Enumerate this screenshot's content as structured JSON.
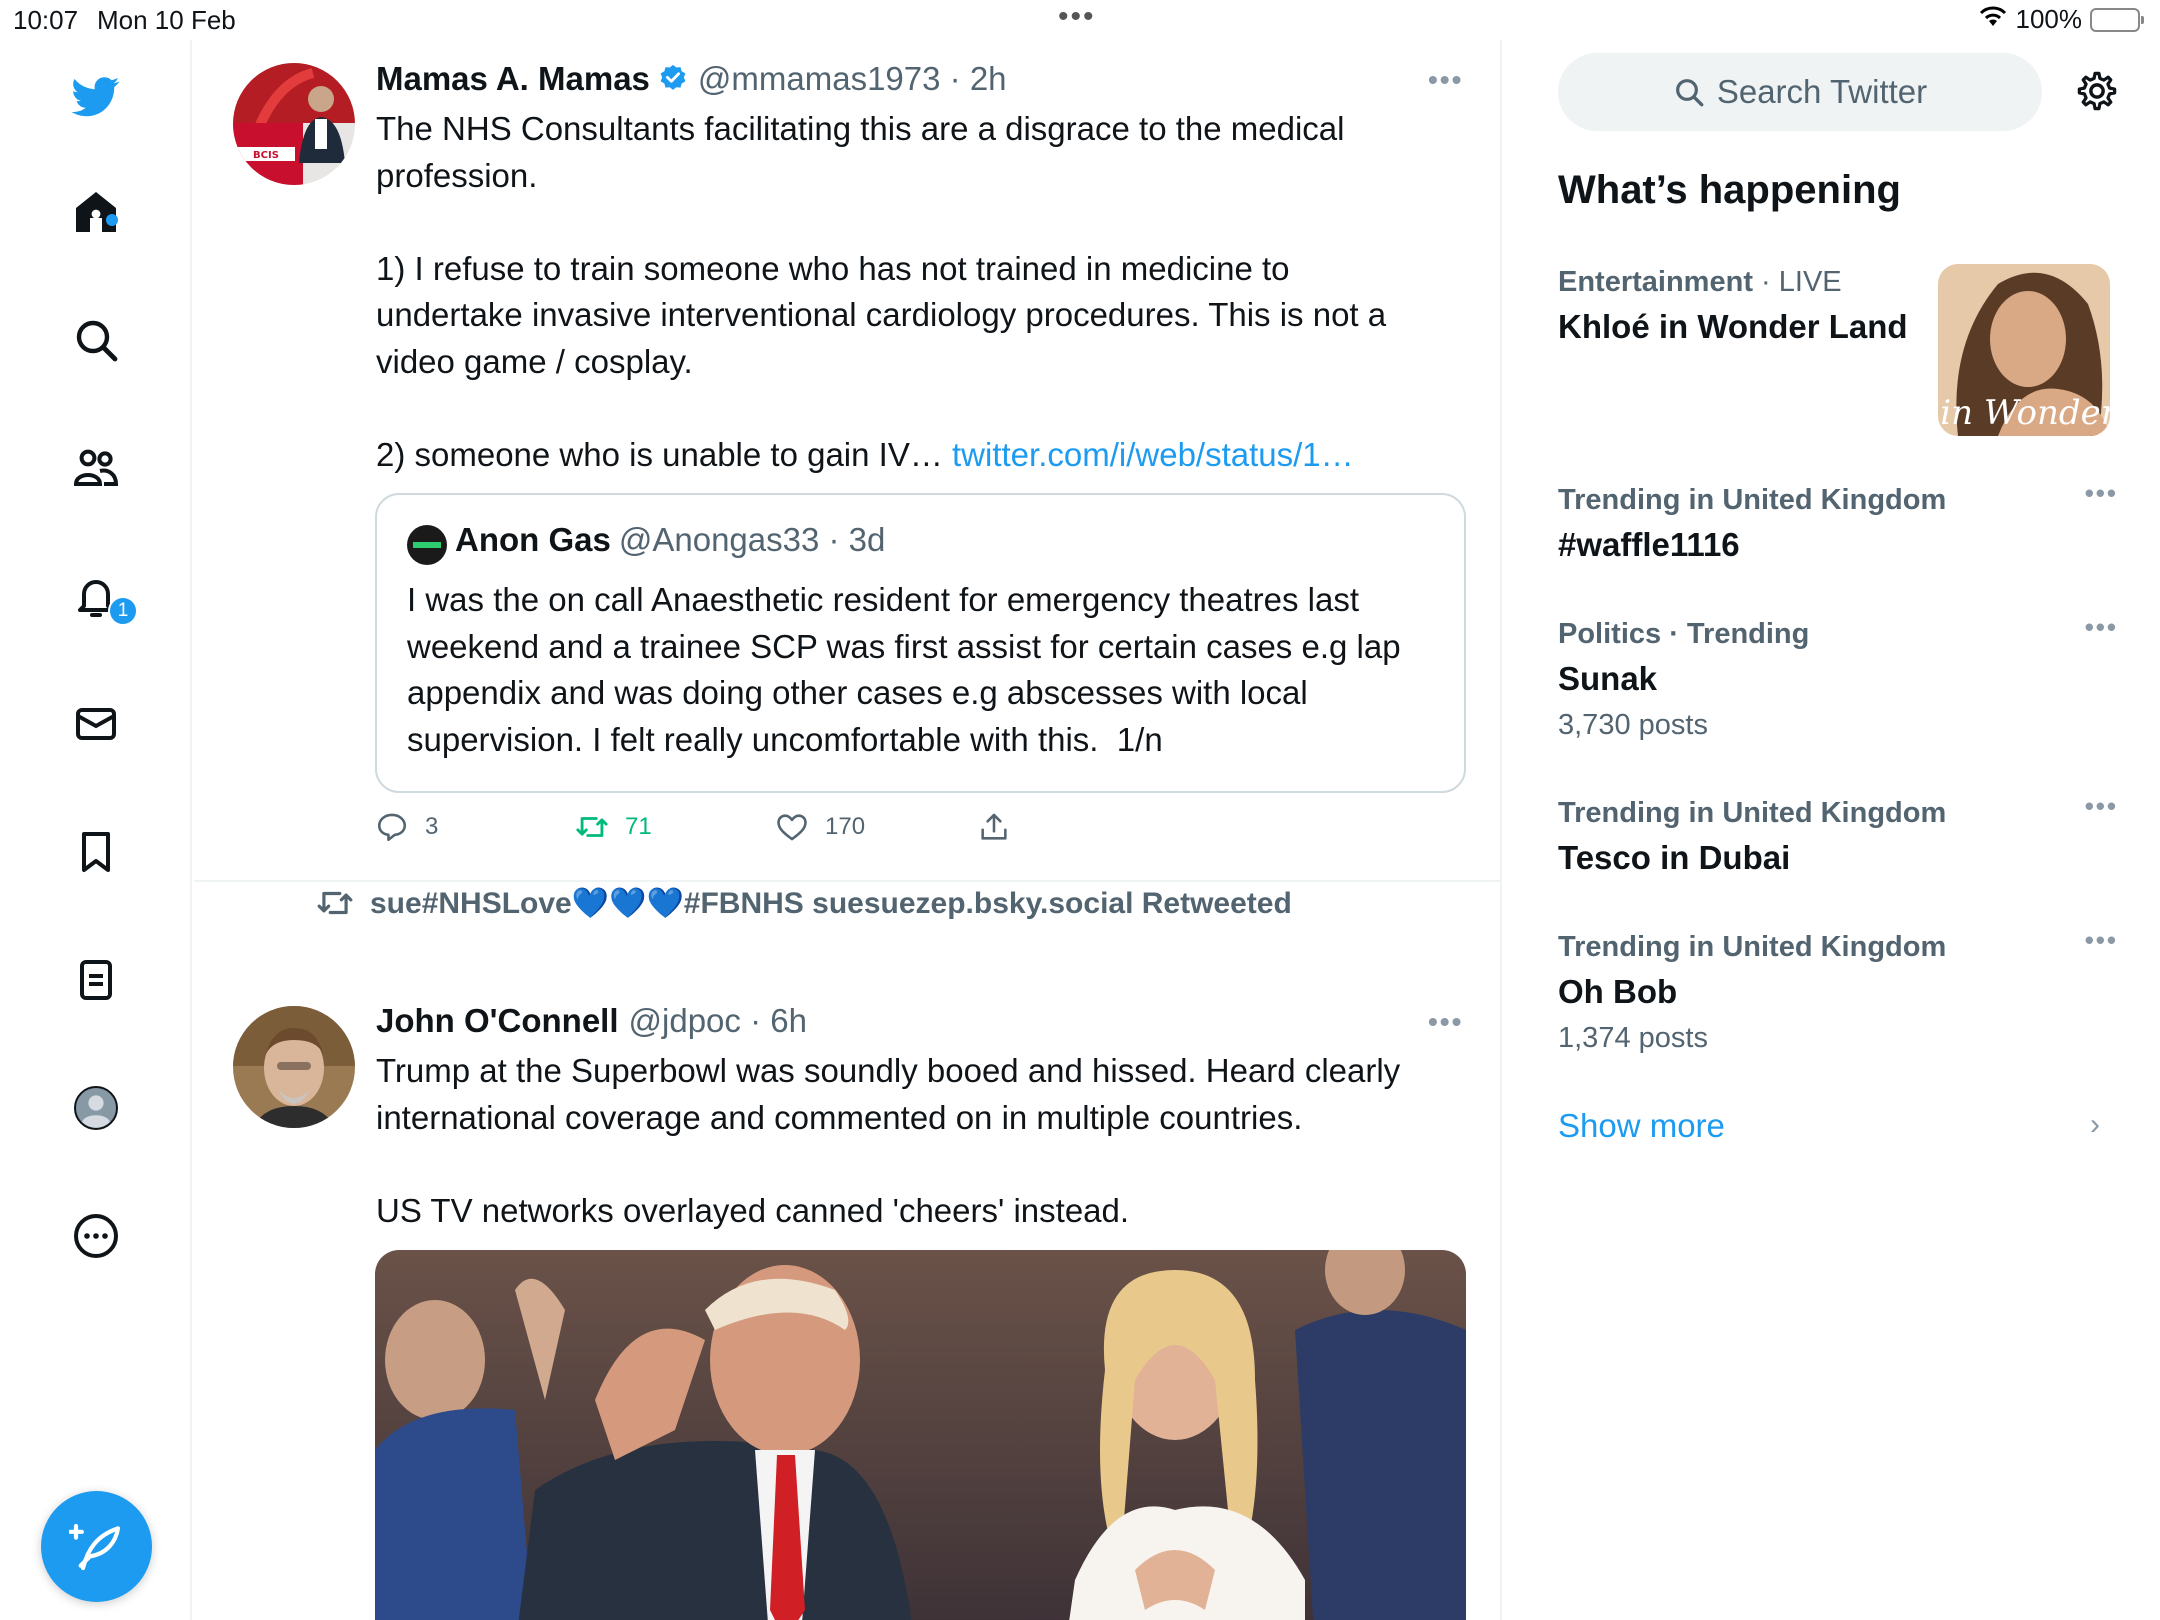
{
  "status_bar": {
    "time": "10:07",
    "date": "Mon 10 Feb",
    "battery": "100%",
    "multitask_dots": "•••"
  },
  "nav": {
    "items": [
      "twitter-logo",
      "home",
      "search",
      "communities",
      "notifications",
      "messages",
      "bookmarks",
      "lists",
      "profile",
      "more"
    ],
    "notifications_badge": "1",
    "accent_color": "#1d9bf0"
  },
  "feed": {
    "tweets": [
      {
        "name": "Mamas A. Mamas",
        "handle": "@mmamas1973 · 2h",
        "verified": true,
        "text": "The NHS Consultants facilitating this are a disgrace to the medical\nprofession.\n\n1) I refuse to train someone who has not trained in medicine to\nundertake invasive interventional cardiology procedures. This is not a\nvideo game / cosplay.\n\n2) someone who is unable to gain IV… ",
        "link": "twitter.com/i/web/status/1…",
        "avatar_label": "BCIS",
        "quote": {
          "name": "Anon Gas",
          "handle": "@Anongas33 · 3d",
          "text": "I was the on call Anaesthetic resident for emergency theatres last\nweekend and a trainee SCP was first assist for certain cases e.g lap\nappendix and was doing other cases e.g abscesses with local\nsupervision. I felt really uncomfortable with this.  1/n"
        },
        "replies": "3",
        "retweets": "71",
        "likes": "170"
      },
      {
        "retweeted_by": "sue#NHSLove💙💙💙#FBNHS suesuezep.bsky.social Retweeted",
        "name": "John O'Connell",
        "handle": "@jdpoc · 6h",
        "text": "Trump at the Superbowl was soundly booed and hissed. Heard clearly\ninternational coverage and commented on in multiple countries.\n\nUS TV networks overlayed canned 'cheers' instead."
      }
    ]
  },
  "sidebar": {
    "search_placeholder": "Search Twitter",
    "heading": "What’s happening",
    "trends": [
      {
        "category": "Entertainment",
        "live": " · LIVE",
        "title": "Khloé in Wonder Land",
        "count": "",
        "thumb_text": "é in Wonder l"
      },
      {
        "category": "Trending in United Kingdom",
        "title": "#waffle1116",
        "count": ""
      },
      {
        "category": "Politics · Trending",
        "title": "Sunak",
        "count": "3,730 posts"
      },
      {
        "category": "Trending in United Kingdom",
        "title": "Tesco in Dubai",
        "count": ""
      },
      {
        "category": "Trending in United Kingdom",
        "title": "Oh Bob",
        "count": "1,374 posts"
      }
    ],
    "show_more": "Show more"
  }
}
